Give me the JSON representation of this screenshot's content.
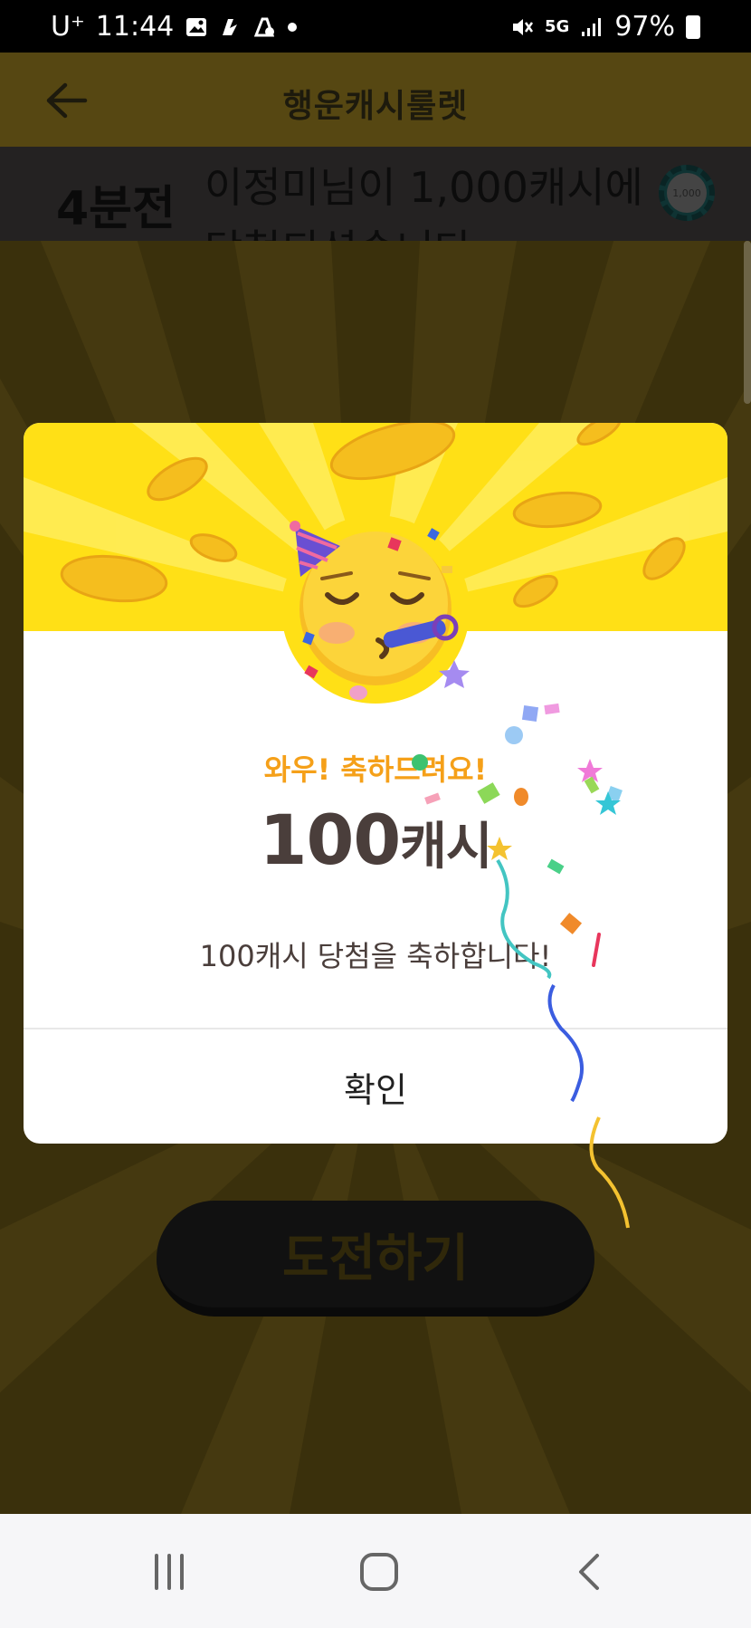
{
  "status_bar": {
    "carrier": "U⁺",
    "time": "11:44",
    "network": "5G",
    "battery": "97%"
  },
  "header": {
    "title": "행운캐시룰렛",
    "back_icon": "arrow-left-icon"
  },
  "ticker": {
    "time_ago": "4분전",
    "message": "이정미님이 1,000캐시에",
    "message_line2": "당첨되셨습니다",
    "chip_label": "1,000"
  },
  "modal": {
    "wow_text": "와우! 축하드려요!",
    "amount_number": "100",
    "amount_unit": "캐시",
    "description": "100캐시 당첨을 축하합니다!",
    "confirm_label": "확인",
    "emoji": "partying-face-emoji"
  },
  "challenge_button": {
    "label": "도전하기"
  },
  "nav_bar": {
    "recent_icon": "recent-apps-icon",
    "home_icon": "home-icon",
    "back_icon": "back-icon"
  },
  "colors": {
    "accent_yellow": "#ffe016",
    "wow_orange": "#f5a019",
    "amount_text": "#4a3e3b",
    "dim_background": "#3a300c"
  }
}
